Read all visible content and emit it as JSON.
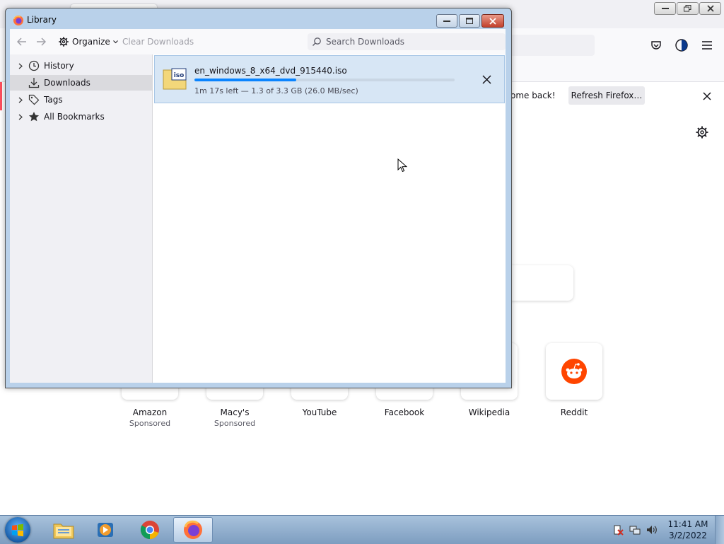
{
  "firefox": {
    "infobar": {
      "welcome_text": "ome back!",
      "refresh_label": "Refresh Firefox…"
    },
    "shortcuts": [
      {
        "name": "Amazon",
        "sponsored": "Sponsored"
      },
      {
        "name": "Macy's",
        "sponsored": "Sponsored"
      },
      {
        "name": "YouTube",
        "sponsored": ""
      },
      {
        "name": "Facebook",
        "sponsored": ""
      },
      {
        "name": "Wikipedia",
        "sponsored": ""
      },
      {
        "name": "Reddit",
        "sponsored": ""
      }
    ]
  },
  "library": {
    "title": "Library",
    "toolbar": {
      "organize_label": "Organize",
      "clear_label": "Clear Downloads",
      "search_placeholder": "Search Downloads"
    },
    "sidebar": {
      "items": [
        {
          "label": "History",
          "icon": "clock-icon"
        },
        {
          "label": "Downloads",
          "icon": "download-icon",
          "selected": true
        },
        {
          "label": "Tags",
          "icon": "tag-icon"
        },
        {
          "label": "All Bookmarks",
          "icon": "star-icon"
        }
      ]
    },
    "download": {
      "filename": "en_windows_8_x64_dvd_915440.iso",
      "status": "1m 17s left — 1.3 of 3.3 GB (26.0 MB/sec)",
      "progress_fraction": 0.39,
      "file_icon": "iso-file-icon"
    }
  },
  "taskbar": {
    "apps": [
      "file-explorer-icon",
      "media-player-icon",
      "chrome-icon",
      "firefox-icon"
    ],
    "clock_time": "11:41 AM",
    "clock_date": "3/2/2022"
  },
  "colors": {
    "accent": "#0a84ff",
    "selection": "#d7e6f5",
    "reddit": "#ff4500"
  }
}
